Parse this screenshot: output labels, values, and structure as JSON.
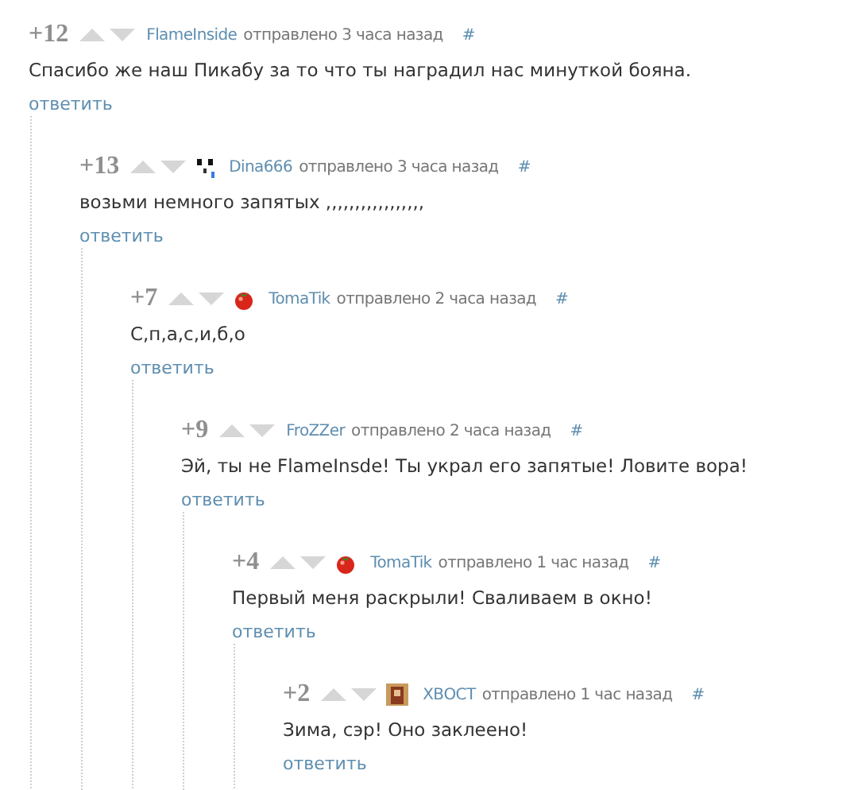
{
  "comments": [
    {
      "score": "+12",
      "author": "FlameInside",
      "posted": "отправлено 3 часа назад",
      "anchor": "#",
      "text": "Спасибо же наш Пикабу за то что ты наградил нас минуткой бояна.",
      "reply": "ответить",
      "children": [
        {
          "score": "+13",
          "author": "Dina666",
          "kind": "panda",
          "posted": "отправлено 3 часа назад",
          "anchor": "#",
          "text": "возьми немного запятых ,,,,,,,,,,,,,,,,,",
          "reply": "ответить",
          "children": [
            {
              "score": "+7",
              "author": "TomaTik",
              "kind": "tomato",
              "posted": "отправлено 2 часа назад",
              "anchor": "#",
              "text": "С,п,а,с,и,б,о",
              "reply": "ответить",
              "children": [
                {
                  "score": "+9",
                  "author": "FroZZer",
                  "posted": "отправлено 2 часа назад",
                  "anchor": "#",
                  "text": "Эй, ты не FlameInsde! Ты украл его запятые! Ловите вора!",
                  "reply": "ответить",
                  "children": [
                    {
                      "score": "+4",
                      "author": "TomaTik",
                      "kind": "tomato",
                      "posted": "отправлено 1 час назад",
                      "anchor": "#",
                      "text": "Первый меня раскрыли! Сваливаем в окно!",
                      "reply": "ответить",
                      "children": [
                        {
                          "score": "+2",
                          "author": "ХВОСТ",
                          "kind": "portrait",
                          "posted": "отправлено 1 час назад",
                          "anchor": "#",
                          "text": "Зима, сэр! Оно заклеено!",
                          "reply": "ответить"
                        }
                      ]
                    }
                  ]
                }
              ]
            }
          ]
        }
      ]
    }
  ]
}
